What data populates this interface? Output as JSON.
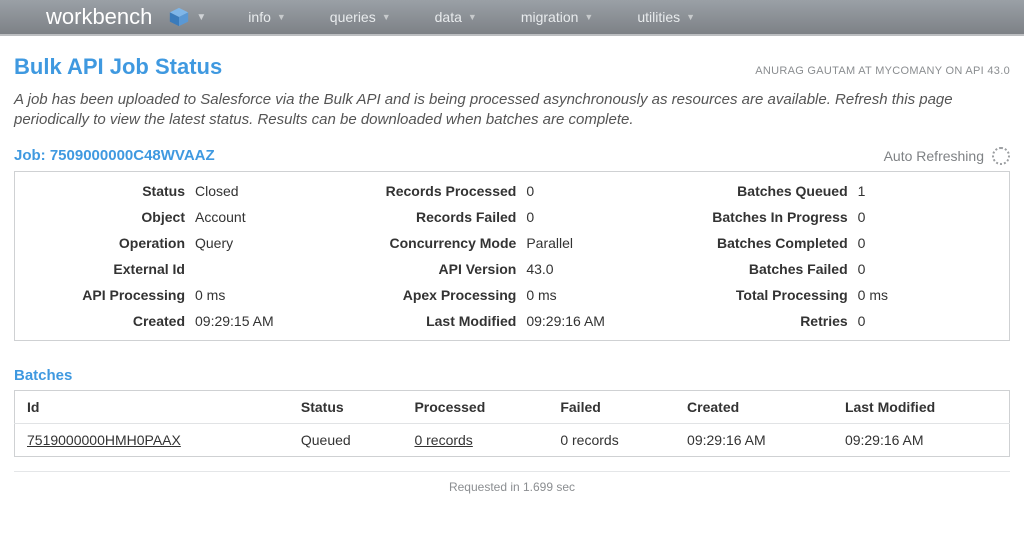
{
  "nav": {
    "brand": "workbench",
    "items": [
      "info",
      "queries",
      "data",
      "migration",
      "utilities"
    ]
  },
  "header": {
    "title": "Bulk API Job Status",
    "subtitle": "ANURAG GAUTAM AT MYCOMANY ON API 43.0",
    "description": "A job has been uploaded to Salesforce via the Bulk API and is being processed asynchronously as resources are available. Refresh this page periodically to view the latest status. Results can be downloaded when batches are complete."
  },
  "job": {
    "label": "Job: 7509000000C48WVAAZ",
    "auto_refresh": "Auto Refreshing"
  },
  "details": {
    "col1": [
      {
        "label": "Status",
        "value": "Closed"
      },
      {
        "label": "Object",
        "value": "Account"
      },
      {
        "label": "Operation",
        "value": "Query"
      },
      {
        "label": "External Id",
        "value": ""
      },
      {
        "label": "API Processing",
        "value": "0 ms"
      },
      {
        "label": "Created",
        "value": "09:29:15 AM"
      }
    ],
    "col2": [
      {
        "label": "Records Processed",
        "value": "0"
      },
      {
        "label": "Records Failed",
        "value": "0"
      },
      {
        "label": "Concurrency Mode",
        "value": "Parallel"
      },
      {
        "label": "API Version",
        "value": "43.0"
      },
      {
        "label": "Apex Processing",
        "value": "0 ms"
      },
      {
        "label": "Last Modified",
        "value": "09:29:16 AM"
      }
    ],
    "col3": [
      {
        "label": "Batches Queued",
        "value": "1"
      },
      {
        "label": "Batches In Progress",
        "value": "0"
      },
      {
        "label": "Batches Completed",
        "value": "0"
      },
      {
        "label": "Batches Failed",
        "value": "0"
      },
      {
        "label": "Total Processing",
        "value": "0 ms"
      },
      {
        "label": "Retries",
        "value": "0"
      }
    ]
  },
  "batches": {
    "heading": "Batches",
    "headers": [
      "Id",
      "Status",
      "Processed",
      "Failed",
      "Created",
      "Last Modified"
    ],
    "rows": [
      {
        "id": "7519000000HMH0PAAX",
        "status": "Queued",
        "processed": "0 records",
        "failed": "0 records",
        "created": "09:29:16 AM",
        "last_modified": "09:29:16 AM"
      }
    ]
  },
  "footer": "Requested in 1.699 sec"
}
